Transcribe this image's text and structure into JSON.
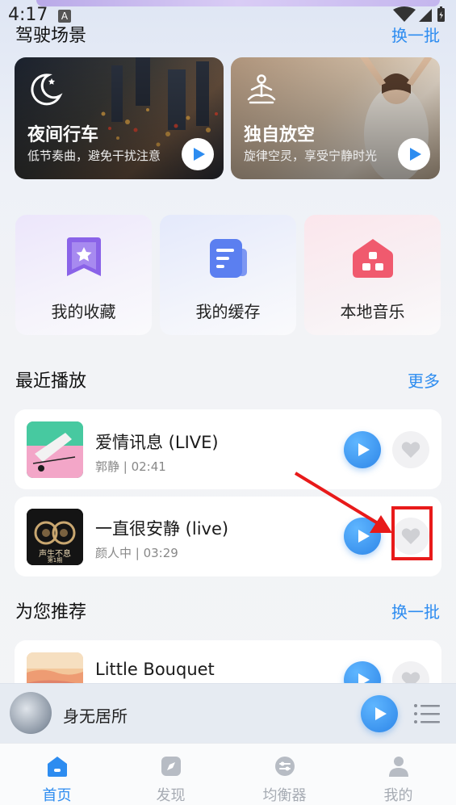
{
  "status_bar": {
    "time": "4:17",
    "notification_letter": "A"
  },
  "driving": {
    "title": "驾驶场景",
    "refresh": "换一批",
    "cards": [
      {
        "title": "夜间行车",
        "subtitle": "低节奏曲，避免干扰注意",
        "icon": "moon-icon"
      },
      {
        "title": "独自放空",
        "subtitle": "旋律空灵，享受宁静时光",
        "icon": "meditation-icon"
      }
    ]
  },
  "quick_tiles": [
    {
      "label": "我的收藏",
      "icon": "star-bookmark-icon",
      "color": "#8a63e8"
    },
    {
      "label": "我的缓存",
      "icon": "document-cache-icon",
      "color": "#5b7ff0"
    },
    {
      "label": "本地音乐",
      "icon": "home-music-icon",
      "color": "#f05a6e"
    }
  ],
  "recent": {
    "title": "最近播放",
    "more": "更多",
    "songs": [
      {
        "title": "爱情讯息 (LIVE)",
        "meta": "郭静 | 02:41"
      },
      {
        "title": "一直很安静 (live)",
        "meta": "颜人中 | 03:29",
        "cover_text": "声生不息",
        "cover_sub": "第1期"
      }
    ]
  },
  "recommend": {
    "title": "为您推荐",
    "refresh": "换一批",
    "songs": [
      {
        "title": "Little Bouquet"
      }
    ]
  },
  "mini_player": {
    "title": "身无居所"
  },
  "tabs": [
    {
      "label": "首页",
      "icon": "home-icon",
      "active": true
    },
    {
      "label": "发现",
      "icon": "compass-icon",
      "active": false
    },
    {
      "label": "均衡器",
      "icon": "equalizer-icon",
      "active": false
    },
    {
      "label": "我的",
      "icon": "person-icon",
      "active": false
    }
  ],
  "colors": {
    "accent": "#2d8cf0",
    "annotation": "#e81a1a"
  }
}
